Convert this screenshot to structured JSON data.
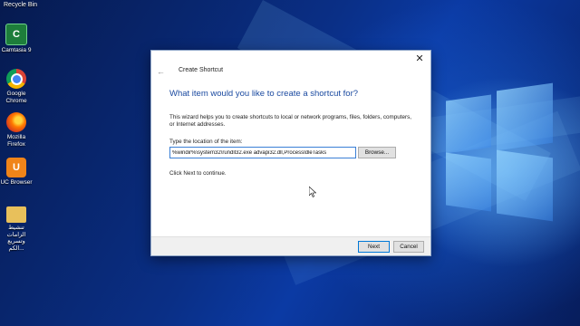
{
  "desktop": {
    "top_label": "Recycle Bin",
    "icons": [
      {
        "label": "Camtasia 9",
        "icon": "camtasia-icon"
      },
      {
        "label": "Google Chrome",
        "icon": "chrome-icon"
      },
      {
        "label": "Mozilla Firefox",
        "icon": "firefox-icon"
      },
      {
        "label": "UC Browser",
        "icon": "uc-browser-icon"
      },
      {
        "label": "تنشيط الزامات وتسريع الكم...",
        "icon": "folder-icon"
      }
    ]
  },
  "dialog": {
    "title": "Create Shortcut",
    "heading": "What item would you like to create a shortcut for?",
    "description": "This wizard helps you to create shortcuts to local or network programs, files, folders, computers, or Internet addresses.",
    "location_label": "Type the location of the item:",
    "location_value": "%windir%\\system32\\rundll32.exe advapi32.dll,ProcessIdleTasks",
    "browse_label": "Browse...",
    "continue_note": "Click Next to continue.",
    "next_label": "Next",
    "cancel_label": "Cancel",
    "close_glyph": "✕",
    "back_glyph": "←"
  },
  "colors": {
    "heading": "#1b4aa0",
    "wallpaper_dark": "#061a4f",
    "wallpaper_light": "#8fd3ff",
    "focus_border": "#3a7fd6"
  }
}
